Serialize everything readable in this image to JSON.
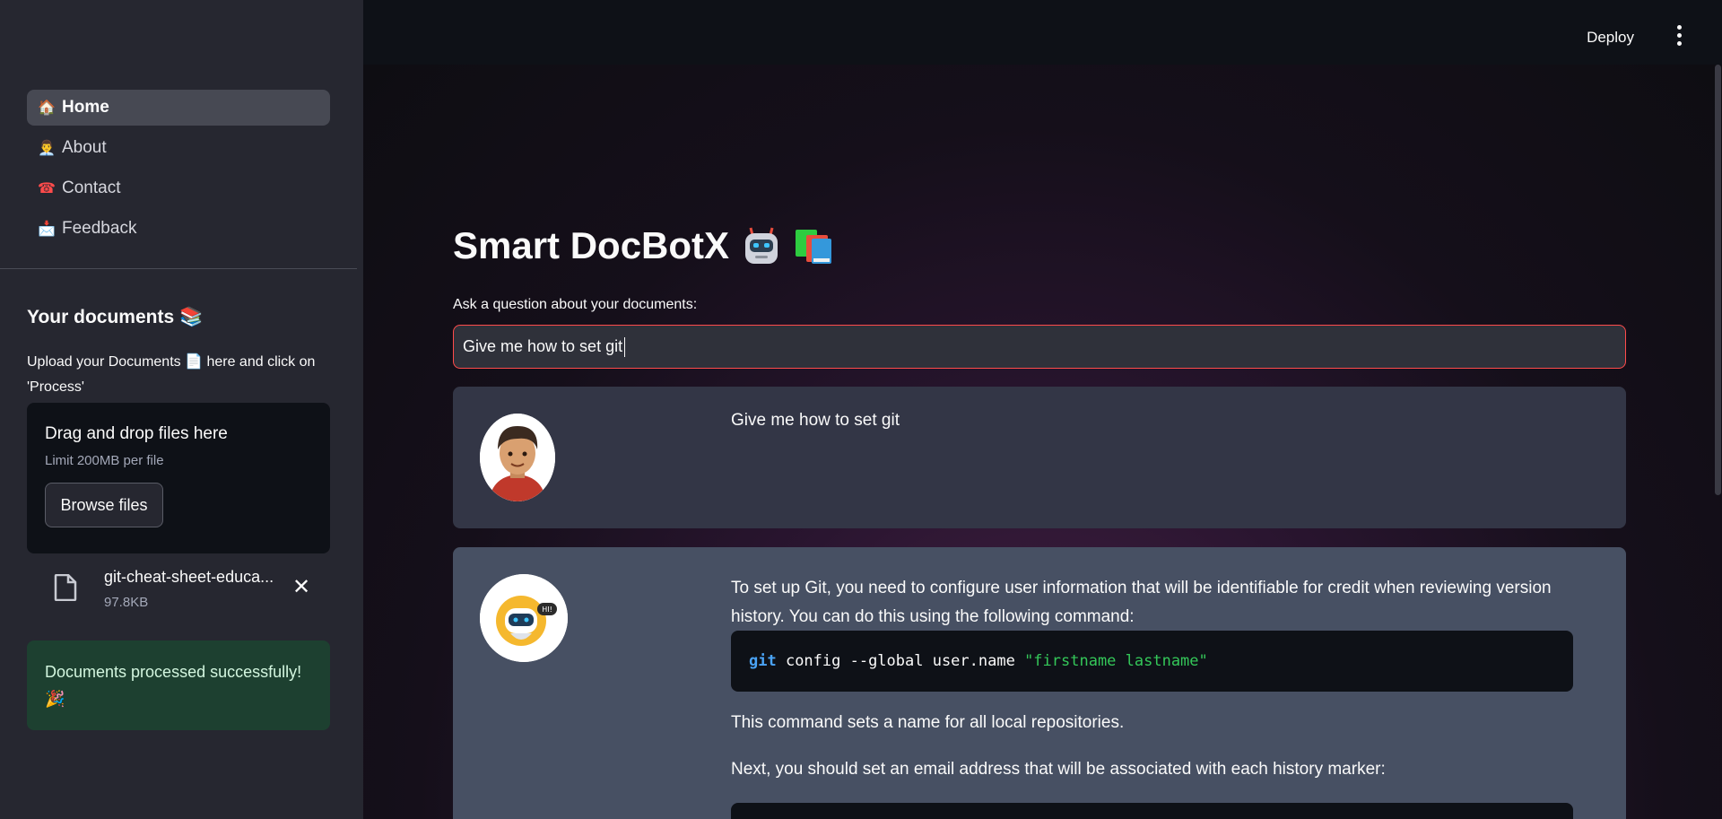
{
  "sidebar": {
    "nav": [
      {
        "emoji": "🏠",
        "label": "Home"
      },
      {
        "emoji": "👨‍💼",
        "label": "About"
      },
      {
        "emoji": "☎",
        "label": "Contact"
      },
      {
        "emoji": "📩",
        "label": "Feedback"
      }
    ],
    "docs_title": "Your documents 📚",
    "docs_desc": "Upload your Documents 📄 here and click on 'Process'",
    "uploader": {
      "title": "Drag and drop files here",
      "limit": "Limit 200MB per file",
      "browse_label": "Browse files"
    },
    "file": {
      "name": "git-cheat-sheet-educa...",
      "size": "97.8KB"
    },
    "success": "Documents processed successfully! 🎉"
  },
  "header": {
    "deploy_label": "Deploy"
  },
  "main": {
    "title": "Smart DocBotX",
    "ask_label": "Ask a question about your documents:",
    "ask_value": "Give me how to set git",
    "user_message": "Give me how to set git",
    "bot": {
      "para1": "To set up Git, you need to configure user information that will be identifiable for credit when reviewing version history. You can do this using the following command:",
      "code1_kw": "git",
      "code1_rest": " config --global user.name ",
      "code1_str": "\"firstname lastname\"",
      "para2": "This command sets a name for all local repositories.",
      "para3": "Next, you should set an email address that will be associated with each history marker:"
    }
  },
  "colors": {
    "accent": "#ff4b4b",
    "success_bg": "#1d4030",
    "sidebar_bg": "#262730"
  }
}
